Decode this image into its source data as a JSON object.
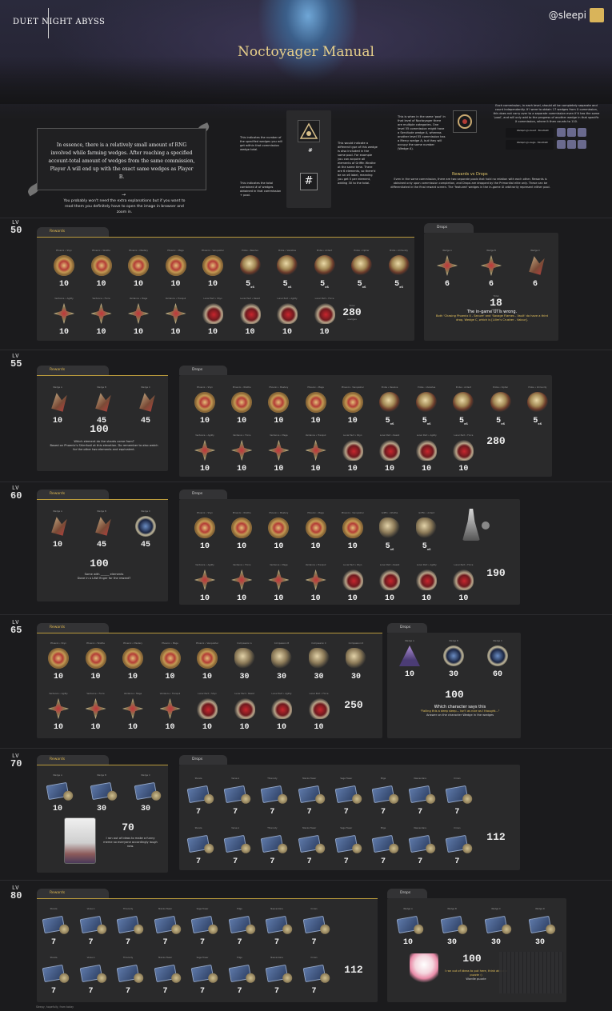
{
  "header": {
    "brand": "DUET NIGHT ABYSS",
    "handle": "@sleepi",
    "title": "Noctoyager Manual"
  },
  "intro": {
    "main_text": "In essence, there is a relatively small amount of RNG involved while farming wedges. After reaching a specified account-total amount of wedges from the same commission, Player A will end up with the exact same wedges as Player B.",
    "arrow": "→",
    "sub_text": "You probably won't need the extra explanations but if you want to read them you definitely have to open the image in browser and zoom in.",
    "legend_symbol": "#",
    "legend_symbol_small": "#",
    "note_count": "This indicates the number of the specified wedges you will get within that commission wedge total.",
    "note_total": "This indicates the total combined # of wedges obtained in that commission + pool.",
    "note_pool": "This would indicate a different type of this wedge is also included in the same pool. For example you can acquire all elements of Griffin Wrathe at the same time. There are 6 elements, so there'd be an x6 label, meaning you get 5 per element, adding 30 to the total.",
    "note_level": "This is when in the same 'pool' in that level of Noctoyager there are multiple categories. One level 55 commission might have a Servitude wedge A, whereas another level 55 commission has a Mercy wedge A, but they will occupy the same number (Wedge A).",
    "note_commission": "Each commission, in each level, should all be completely separate and count independently. If I were to obtain 17 wedges from X commission, this does not carry over to a separate commission even if it has the same 'pool', and will only add to the progress of another wedge in that specific X commission, where it then counts to 110.",
    "rd_title": "Rewards vs Drops",
    "rd_body": "Even in the same commission, there are two separate pools that hold no relation with each other. Rewards is obtained only upon commission completion, and Drops are dropped by the Primordial elite only. These can be differentiated in the final reward screen. The 'featured' wedges in the in-game UI arbitrarily represent either pool.",
    "mini_bar_1": "Wellspring's Guard · Bloodbath",
    "mini_bar_2": "Wellspring's Aegis · Bloodbath"
  },
  "sections": [
    {
      "lv_label": "LV",
      "level": "50",
      "rewards_tab": "Rewards",
      "drops_tab": "Drops",
      "rewards_row1": [
        {
          "label": "Phoenix • Shyn",
          "count": "10"
        },
        {
          "label": "Phoenix • Wrathe",
          "count": "10"
        },
        {
          "label": "Phoenix • Mastery",
          "count": "10"
        },
        {
          "label": "Phoenix • Mage",
          "count": "10"
        },
        {
          "label": "Phoenix • Vanquisher",
          "count": "10"
        },
        {
          "label": "Probe • Resolve",
          "count": "5",
          "suffix": "x6"
        },
        {
          "label": "Probe • Vanishes",
          "count": "5",
          "suffix": "x6"
        },
        {
          "label": "Probe • Ardent",
          "count": "5",
          "suffix": "x6"
        },
        {
          "label": "Probe • Cipher",
          "count": "5",
          "suffix": "x6"
        },
        {
          "label": "Probe • Immunity",
          "count": "5",
          "suffix": "x6"
        }
      ],
      "rewards_row2": [
        {
          "label": "Verdance • Agility",
          "count": "10"
        },
        {
          "label": "Verdance • Force",
          "count": "10"
        },
        {
          "label": "Verdance • Mage",
          "count": "10"
        },
        {
          "label": "Verdance • Tranquil",
          "count": "10"
        },
        {
          "label": "Lunar Pact • Shyn",
          "count": "10"
        },
        {
          "label": "Lunar Pact • Resist",
          "count": "10"
        },
        {
          "label": "Lunar Pact • Agility",
          "count": "10"
        },
        {
          "label": "Lunar Pact • Force",
          "count": "10"
        }
      ],
      "rewards_total": "280",
      "total_small": "Total",
      "total_sub": "wedges",
      "drops": [
        {
          "label": "Wedge A",
          "count": "6"
        },
        {
          "label": "Wedge B",
          "count": "6"
        },
        {
          "label": "Wedge C",
          "count": "6"
        }
      ],
      "drops_total": "18",
      "drops_caption_title": "The in-game UI is wrong.",
      "drops_caption": "Both 'Chasing Phoenix II - Secure' and 'Savage Flames - Vault' do have a third drop, Wedge C, which is [Lilim's Crusher - Valour]."
    },
    {
      "lv_label": "LV",
      "level": "55",
      "rewards_tab": "Rewards",
      "drops_tab": "Drops",
      "rewards": [
        {
          "label": "Wedge A",
          "count": "10"
        },
        {
          "label": "Wedge B",
          "count": "45"
        },
        {
          "label": "Wedge C",
          "count": "45"
        }
      ],
      "rewards_total": "100",
      "rewards_caption": "Which element do the shards come from?",
      "rewards_caption2": "Based on Phoenix's Shimfusil at this elevation. Do remember to also watch for the other two elements and equivalent.",
      "drops_row1": [
        {
          "label": "Phoenix • Shyn",
          "count": "10"
        },
        {
          "label": "Phoenix • Wrathe",
          "count": "10"
        },
        {
          "label": "Phoenix • Mastery",
          "count": "10"
        },
        {
          "label": "Phoenix • Mage",
          "count": "10"
        },
        {
          "label": "Phoenix • Vanquisher",
          "count": "10"
        },
        {
          "label": "Probe • Resolve",
          "count": "5",
          "suffix": "x6"
        },
        {
          "label": "Probe • Vanishes",
          "count": "5",
          "suffix": "x6"
        },
        {
          "label": "Probe • Ardent",
          "count": "5",
          "suffix": "x6"
        },
        {
          "label": "Probe • Cipher",
          "count": "5",
          "suffix": "x6"
        },
        {
          "label": "Probe • Immunity",
          "count": "5",
          "suffix": "x6"
        }
      ],
      "drops_row2": [
        {
          "label": "Verdance • Agility",
          "count": "10"
        },
        {
          "label": "Verdance • Force",
          "count": "10"
        },
        {
          "label": "Verdance • Mage",
          "count": "10"
        },
        {
          "label": "Verdance • Tranquil",
          "count": "10"
        },
        {
          "label": "Lunar Pact • Shyn",
          "count": "10"
        },
        {
          "label": "Lunar Pact • Resist",
          "count": "10"
        },
        {
          "label": "Lunar Pact • Agility",
          "count": "10"
        },
        {
          "label": "Lunar Pact • Force",
          "count": "10"
        }
      ],
      "drops_total": "280"
    },
    {
      "lv_label": "LV",
      "level": "60",
      "rewards_tab": "Rewards",
      "drops_tab": "Drops",
      "rewards": [
        {
          "label": "Wedge A",
          "count": "10"
        },
        {
          "label": "Wedge B",
          "count": "45"
        },
        {
          "label": "Wedge C",
          "count": "45"
        }
      ],
      "rewards_total": "100",
      "rewards_caption": "Same with ______ elements",
      "rewards_caption2": "Done in a LAW finger for the reward?",
      "drops_row1": [
        {
          "label": "Phoenix • Shyn",
          "count": "10"
        },
        {
          "label": "Phoenix • Wrathe",
          "count": "10"
        },
        {
          "label": "Phoenix • Mastery",
          "count": "10"
        },
        {
          "label": "Phoenix • Mage",
          "count": "10"
        },
        {
          "label": "Phoenix • Vanquisher",
          "count": "10"
        },
        {
          "label": "Griffin • Wrathe",
          "count": "5",
          "suffix": "x6"
        },
        {
          "label": "Griffin • Ardent",
          "count": "5",
          "suffix": "x6"
        }
      ],
      "drops_row2": [
        {
          "label": "Verdance • Agility",
          "count": "10"
        },
        {
          "label": "Verdance • Force",
          "count": "10"
        },
        {
          "label": "Verdance • Mage",
          "count": "10"
        },
        {
          "label": "Verdance • Tranquil",
          "count": "10"
        },
        {
          "label": "Lunar Pact • Shyn",
          "count": "10"
        },
        {
          "label": "Lunar Pact • Resist",
          "count": "10"
        },
        {
          "label": "Lunar Pact • Agility",
          "count": "10"
        },
        {
          "label": "Lunar Pact • Force",
          "count": "10"
        }
      ],
      "drops_total": "190"
    },
    {
      "lv_label": "LV",
      "level": "65",
      "rewards_tab": "Rewards",
      "drops_tab": "Drops",
      "rewards_row1": [
        {
          "label": "Phoenix • Shyn",
          "count": "10"
        },
        {
          "label": "Phoenix • Wrathe",
          "count": "10"
        },
        {
          "label": "Phoenix • Mastery",
          "count": "10"
        },
        {
          "label": "Phoenix • Mage",
          "count": "10"
        },
        {
          "label": "Phoenix • Vanquisher",
          "count": "10"
        },
        {
          "label": "Compassion A",
          "count": "30"
        },
        {
          "label": "Compassion B",
          "count": "30"
        },
        {
          "label": "Compassion C",
          "count": "30"
        },
        {
          "label": "Compassion D",
          "count": "30"
        }
      ],
      "rewards_row2": [
        {
          "label": "Verdance • Agility",
          "count": "10"
        },
        {
          "label": "Verdance • Force",
          "count": "10"
        },
        {
          "label": "Verdance • Mage",
          "count": "10"
        },
        {
          "label": "Verdance • Tranquil",
          "count": "10"
        },
        {
          "label": "Lunar Pact • Shyn",
          "count": "10"
        },
        {
          "label": "Lunar Pact • Resist",
          "count": "10"
        },
        {
          "label": "Lunar Pact • Agility",
          "count": "10"
        },
        {
          "label": "Lunar Pact • Force",
          "count": "10"
        }
      ],
      "rewards_total": "250",
      "drops": [
        {
          "label": "Wedge A",
          "count": "10"
        },
        {
          "label": "Wedge B",
          "count": "30"
        },
        {
          "label": "Wedge C",
          "count": "60"
        }
      ],
      "drops_total": "100",
      "drops_caption_title": "Which character says this",
      "drops_caption": "\"Falling this a deep sleep... Isn't as nice as I thought...\"",
      "drops_caption2": "Answer on the character Wedge in the wedges"
    },
    {
      "lv_label": "LV",
      "level": "70",
      "rewards_tab": "Rewards",
      "drops_tab": "Drops",
      "rewards": [
        {
          "label": "Wedge A",
          "count": "10"
        },
        {
          "label": "Wedge B",
          "count": "30"
        },
        {
          "label": "Wedge C",
          "count": "30"
        }
      ],
      "rewards_total": "70",
      "rewards_caption": "I ran out of ideas to make a funny meme so everyone accordingly laugh now.",
      "drops_row1": [
        {
          "label": "Stanza",
          "count": "7"
        },
        {
          "label": "Verse A",
          "count": "7"
        },
        {
          "label": "Threnody",
          "count": "7"
        },
        {
          "label": "Stanza Tower",
          "count": "7"
        },
        {
          "label": "Sage Tower",
          "count": "7"
        },
        {
          "label": "Edge",
          "count": "7"
        },
        {
          "label": "Nascendara",
          "count": "7"
        },
        {
          "label": "Crown",
          "count": "7"
        }
      ],
      "drops_row2": [
        {
          "label": "Stanza",
          "count": "7"
        },
        {
          "label": "Verse A",
          "count": "7"
        },
        {
          "label": "Threnody",
          "count": "7"
        },
        {
          "label": "Stanza Tower",
          "count": "7"
        },
        {
          "label": "Sage Tower",
          "count": "7"
        },
        {
          "label": "Edge",
          "count": "7"
        },
        {
          "label": "Nascendara",
          "count": "7"
        },
        {
          "label": "Crown",
          "count": "7"
        }
      ],
      "drops_total": "112"
    },
    {
      "lv_label": "LV",
      "level": "80",
      "rewards_tab": "Rewards",
      "drops_tab": "Drops",
      "rewards_row1": [
        {
          "label": "Stanza",
          "count": "7"
        },
        {
          "label": "Verse A",
          "count": "7"
        },
        {
          "label": "Threnody",
          "count": "7"
        },
        {
          "label": "Stanza Tower",
          "count": "7"
        },
        {
          "label": "Sage Tower",
          "count": "7"
        },
        {
          "label": "Edge",
          "count": "7"
        },
        {
          "label": "Nascendara",
          "count": "7"
        },
        {
          "label": "Crown",
          "count": "7"
        }
      ],
      "rewards_row2": [
        {
          "label": "Stanza",
          "count": "7"
        },
        {
          "label": "Verse A",
          "count": "7"
        },
        {
          "label": "Threnody",
          "count": "7"
        },
        {
          "label": "Stanza Tower",
          "count": "7"
        },
        {
          "label": "Sage Tower",
          "count": "7"
        },
        {
          "label": "Edge",
          "count": "7"
        },
        {
          "label": "Nascendara",
          "count": "7"
        },
        {
          "label": "Crown",
          "count": "7"
        }
      ],
      "rewards_total": "112",
      "drops": [
        {
          "label": "Wedge A",
          "count": "10"
        },
        {
          "label": "Wedge B",
          "count": "30"
        },
        {
          "label": "Wedge C",
          "count": "30"
        },
        {
          "label": "Wedge D",
          "count": "30"
        }
      ],
      "drops_total": "100",
      "drops_caption": "I ran out of ideas to put here, think about a puzzle :)",
      "drops_caption_small": "Wordle puzzle"
    }
  ],
  "footer": "Sleepy, hopefully, from today"
}
